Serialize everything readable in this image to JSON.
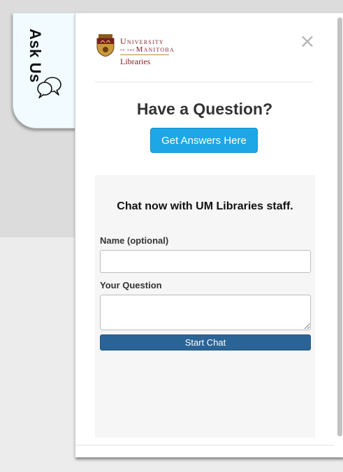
{
  "tab": {
    "label": "Ask Us",
    "icon": "speech-bubbles-icon"
  },
  "logo": {
    "line1": "University",
    "line2_prefix": "of the",
    "line2": "Manitoba",
    "line3": "Libraries",
    "crest_icon": "university-crest-icon",
    "color": "#7a1f1f"
  },
  "panel": {
    "close_glyph": "×",
    "close_icon": "close-icon",
    "heading": "Have a Question?",
    "cta_label": "Get Answers Here",
    "cta_color": "#1ea7e6"
  },
  "chat": {
    "title": "Chat now with UM Libraries staff.",
    "name_label": "Name (optional)",
    "name_value": "",
    "question_label": "Your Question",
    "question_value": "",
    "start_label": "Start Chat",
    "start_color": "#2a6496"
  }
}
